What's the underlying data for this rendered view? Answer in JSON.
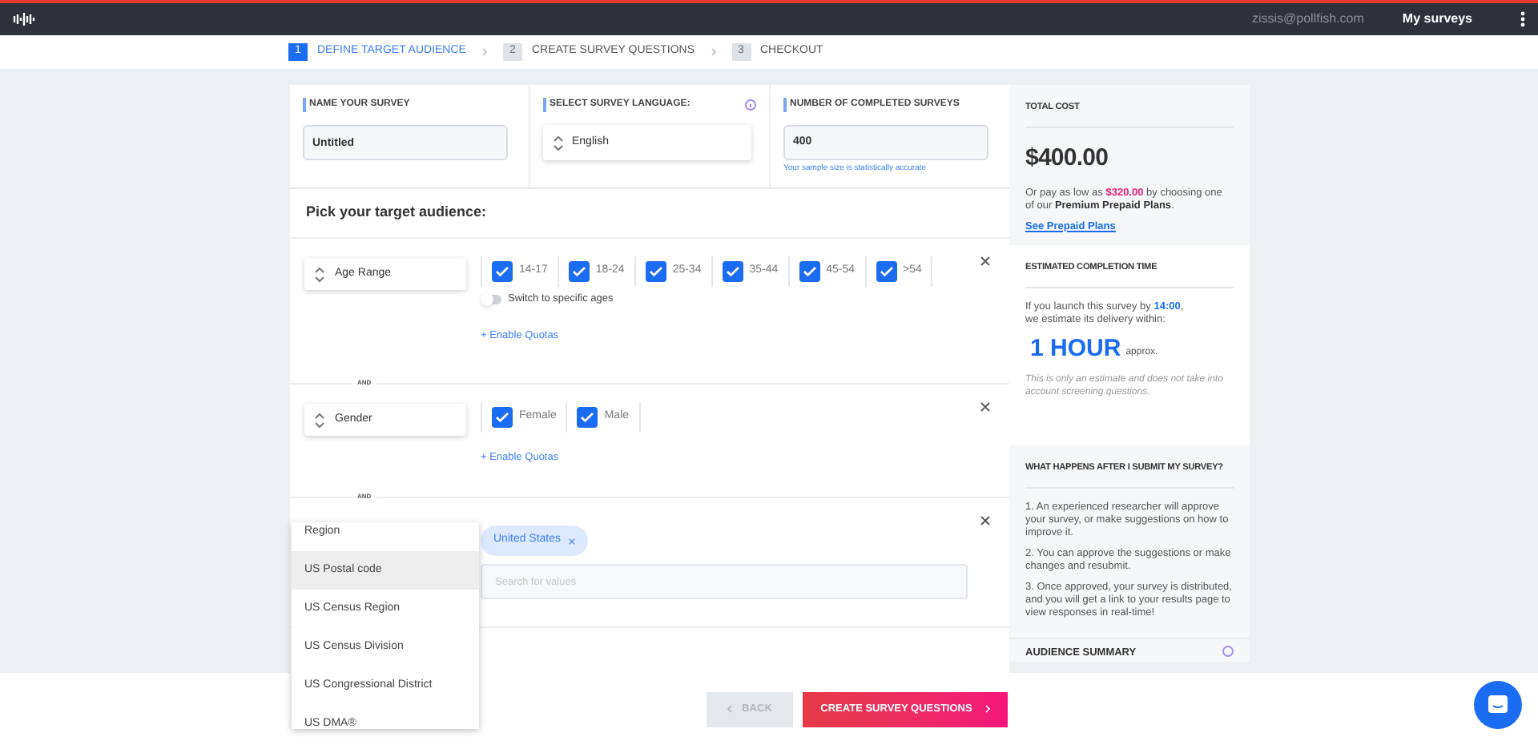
{
  "header": {
    "email": "zissis@pollfish.com",
    "menu_link": "My surveys"
  },
  "steps": [
    {
      "number": "1",
      "label": "DEFINE TARGET AUDIENCE",
      "selected": true
    },
    {
      "number": "2",
      "label": "CREATE SURVEY QUESTIONS",
      "selected": false
    },
    {
      "number": "3",
      "label": "CHECKOUT",
      "selected": false
    }
  ],
  "settings": {
    "name": {
      "label": "NAME YOUR SURVEY",
      "value": "Untitled"
    },
    "language": {
      "label": "SELECT SURVEY LANGUAGE:",
      "value": "English"
    },
    "completes": {
      "label": "NUMBER OF COMPLETED SURVEYS",
      "value": "400",
      "hint": "Your sample size is statistically accurate"
    }
  },
  "audience": {
    "title": "Pick your target audience:",
    "criteria": [
      {
        "kind": "checkboxes",
        "selector": "Age Range",
        "options": [
          {
            "label": "14-17",
            "checked": true
          },
          {
            "label": "18-24",
            "checked": true
          },
          {
            "label": "25-34",
            "checked": true
          },
          {
            "label": "35-44",
            "checked": true
          },
          {
            "label": "45-54",
            "checked": true
          },
          {
            "label": ">54",
            "checked": true
          }
        ],
        "toggle": {
          "label": "Switch to specific ages",
          "on": false
        },
        "quotas_link": "+ Enable Quotas"
      },
      {
        "kind": "checkboxes",
        "connector": "AND",
        "selector": "Gender",
        "options": [
          {
            "label": "Female",
            "checked": true
          },
          {
            "label": "Male",
            "checked": true
          }
        ],
        "quotas_link": "+ Enable Quotas"
      },
      {
        "kind": "tags",
        "connector": "AND",
        "tags": [
          {
            "label": "United States"
          }
        ],
        "search_placeholder": "Search for values"
      }
    ]
  },
  "dropdown": {
    "items": [
      {
        "label": "Region",
        "selected": false
      },
      {
        "label": "US Postal code",
        "selected": true
      },
      {
        "label": "US Census Region",
        "selected": false
      },
      {
        "label": "US Census Division",
        "selected": false
      },
      {
        "label": "US Congressional District",
        "selected": false
      },
      {
        "label": "US DMA®",
        "selected": false
      }
    ]
  },
  "sidebar": {
    "total_cost": {
      "title": "TOTAL COST",
      "amount": "$400.00",
      "text": "Or pay as low as **$320.00** by choosing one of our **Premium Prepaid Plans**.",
      "link": "See Prepaid Plans"
    },
    "completion": {
      "title": "ESTIMATED COMPLETION TIME",
      "text": "If you launch this survey by **14:00**,\nwe estimate its delivery within:",
      "duration": "1 HOUR",
      "suffix": "approx.",
      "note": "This is only an estimate and does not take into account screening questions."
    },
    "after_submit": {
      "title": "WHAT HAPPENS AFTER I SUBMIT MY SURVEY?",
      "steps": [
        "1. An experienced researcher will approve your survey, or make suggestions on how to improve it.",
        "2. You can approve the suggestions or make changes and resubmit.",
        "3. Once approved, your survey is distributed, and you will get a link to your results page to view responses in real-time!"
      ]
    },
    "audience_summary": {
      "title": "AUDIENCE SUMMARY"
    }
  },
  "footer": {
    "back": "BACK",
    "next": "CREATE SURVEY QUESTIONS"
  }
}
